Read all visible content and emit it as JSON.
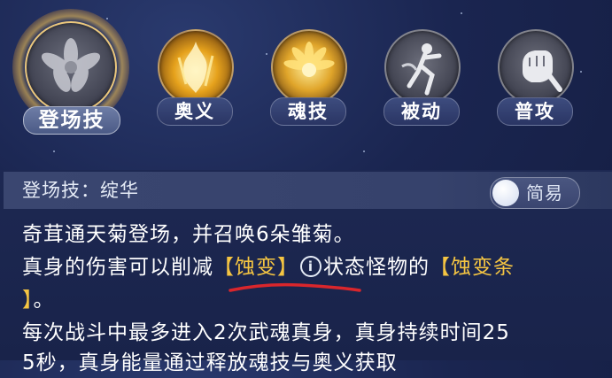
{
  "skills": [
    {
      "id": "entrance",
      "label": "登场技",
      "icon": "dark-flower-icon",
      "active": true
    },
    {
      "id": "ultimate",
      "label": "奥义",
      "icon": "golden-flame-icon",
      "active": false
    },
    {
      "id": "soul",
      "label": "魂技",
      "icon": "golden-chrysanthemum-icon",
      "active": false
    },
    {
      "id": "passive",
      "label": "被动",
      "icon": "dancer-silhouette-icon",
      "active": false
    },
    {
      "id": "basic",
      "label": "普攻",
      "icon": "fist-icon",
      "active": false
    }
  ],
  "panel": {
    "title": "登场技：绽华",
    "toggle_label": "简易",
    "line1": "奇茸通天菊登场，并召唤6朵雏菊。",
    "line2_a": "真身的伤害可以削减",
    "line2_kw1": "【蚀变】",
    "line2_info": "i",
    "line2_b": "状态怪物的",
    "line2_kw2": "【蚀变条",
    "line3_kw": "】",
    "line3_rest": "。",
    "line4": "每次战斗中最多进入2次武魂真身，真身持续时间25",
    "line5": "5秒，真身能量通过释放魂技与奥义获取"
  },
  "colors": {
    "keyword": "#f5c542",
    "annotation": "#d9262c",
    "background": "#1a2550"
  }
}
